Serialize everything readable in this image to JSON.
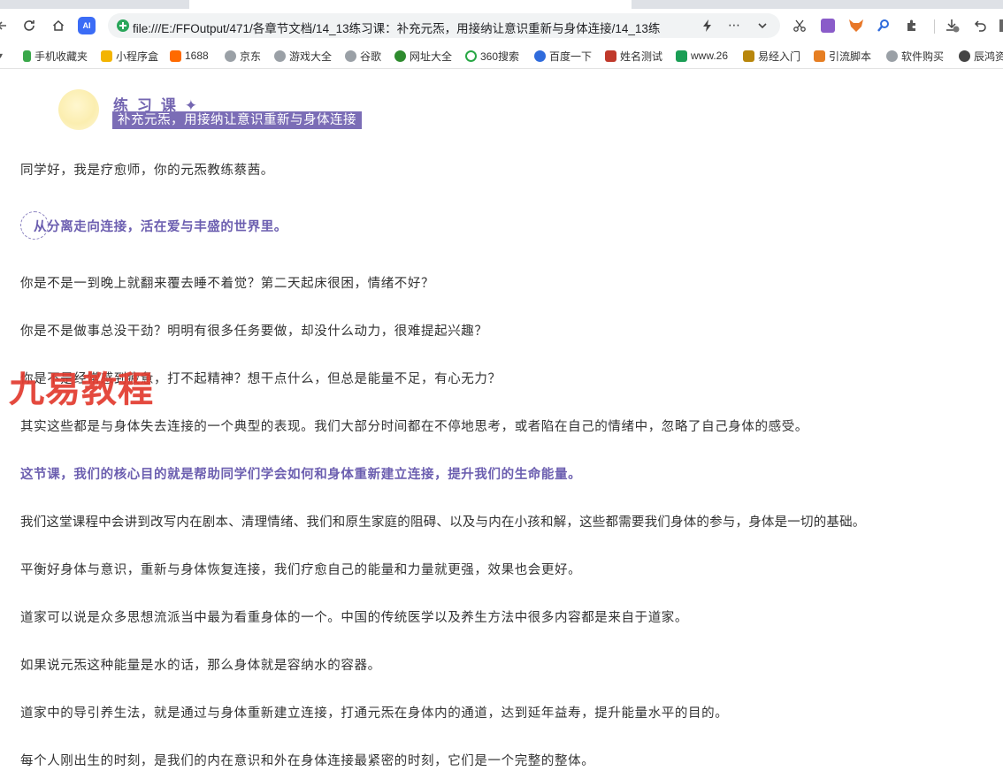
{
  "browser": {
    "url": "file:///E:/FFOutput/471/各章节文档/14_13练习课：补充元炁，用接纳让意识重新与身体连接/14_13练",
    "ai_badge": "AI",
    "bookmarks": [
      {
        "label": "手机收藏夹",
        "color": "#3aa84a"
      },
      {
        "label": "小程序盒",
        "color": "#f3b400"
      },
      {
        "label": "1688",
        "color": "#ff6a00"
      },
      {
        "label": "京东",
        "color": "#9aa0a6"
      },
      {
        "label": "游戏大全",
        "color": "#9aa0a6"
      },
      {
        "label": "谷歌",
        "color": "#9aa0a6"
      },
      {
        "label": "网址大全",
        "color": "#2e8b2e"
      },
      {
        "label": "360搜索",
        "color": "#28a745"
      },
      {
        "label": "百度一下",
        "color": "#2f6bdc"
      },
      {
        "label": "姓名测试",
        "color": "#c0392b"
      },
      {
        "label": "www.26",
        "color": "#1a9e55"
      },
      {
        "label": "易经入门",
        "color": "#b8860b"
      },
      {
        "label": "引流脚本",
        "color": "#e67e22"
      },
      {
        "label": "软件购买",
        "color": "#9aa0a6"
      },
      {
        "label": "辰鸿资",
        "color": "#444444"
      }
    ]
  },
  "lesson": {
    "title": "练 习 课 ✦",
    "subtitle": "补充元炁，用接纳让意识重新与身体连接"
  },
  "article": {
    "intro": "同学好，我是疗愈师，你的元炁教练蔡茜。",
    "quote": "从分离走向连接，活在爱与丰盛的世界里。",
    "paragraphs": [
      "你是不是一到晚上就翻来覆去睡不着觉？第二天起床很困，情绪不好？",
      "你是不是做事总没干劲？明明有很多任务要做，却没什么动力，很难提起兴趣？",
      "你是不是经常感到疲惫，打不起精神？想干点什么，但总是能量不足，有心无力？",
      "其实这些都是与身体失去连接的一个典型的表现。我们大部分时间都在不停地思考，或者陷在自己的情绪中，忽略了自己身体的感受。",
      "这节课，我们的核心目的就是帮助同学们学会如何和身体重新建立连接，提升我们的生命能量。",
      "我们这堂课程中会讲到改写内在剧本、清理情绪、我们和原生家庭的阻碍、以及与内在小孩和解，这些都需要我们身体的参与，身体是一切的基础。",
      "平衡好身体与意识，重新与身体恢复连接，我们疗愈自己的能量和力量就更强，效果也会更好。",
      "道家可以说是众多思想流派当中最为看重身体的一个。中国的传统医学以及养生方法中很多内容都是来自于道家。",
      "如果说元炁这种能量是水的话，那么身体就是容纳水的容器。",
      "道家中的导引养生法，就是通过与身体重新建立连接，打通元炁在身体内的通道，达到延年益寿，提升能量水平的目的。",
      "每个人刚出生的时刻，是我们的内在意识和外在身体连接最紧密的时刻，它们是一个完整的整体。"
    ]
  },
  "watermark": "九易教程",
  "colors": {
    "accent": "#7466b1",
    "subtitle_bg": "#7b6db6",
    "watermark": "#e23a2e",
    "text": "#333333"
  }
}
